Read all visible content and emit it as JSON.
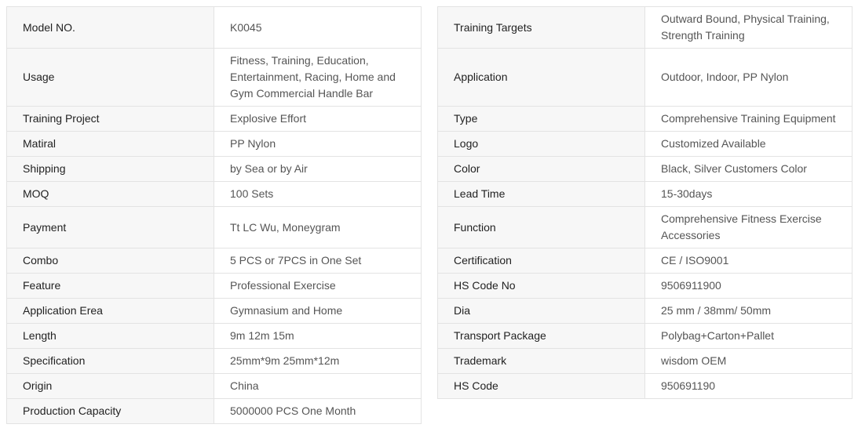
{
  "left_table": [
    {
      "label": "Model NO.",
      "value": "K0045"
    },
    {
      "label": "Usage",
      "value": "Fitness, Training, Education, Entertainment, Racing, Home and Gym Commercial Handle Bar"
    },
    {
      "label": "Training Project",
      "value": "Explosive Effort"
    },
    {
      "label": "Matiral",
      "value": "PP Nylon"
    },
    {
      "label": "Shipping",
      "value": "by Sea or by Air"
    },
    {
      "label": "MOQ",
      "value": "100 Sets"
    },
    {
      "label": "Payment",
      "value": "Tt LC Wu, Moneygram"
    },
    {
      "label": "Combo",
      "value": "5 PCS or 7PCS in One Set"
    },
    {
      "label": "Feature",
      "value": "Professional Exercise"
    },
    {
      "label": "Application Erea",
      "value": "Gymnasium and Home"
    },
    {
      "label": "Length",
      "value": "9m 12m 15m"
    },
    {
      "label": "Specification",
      "value": "25mm*9m 25mm*12m"
    },
    {
      "label": "Origin",
      "value": "China"
    },
    {
      "label": "Production Capacity",
      "value": "5000000 PCS One Month"
    }
  ],
  "right_table": [
    {
      "label": "Training Targets",
      "value": "Outward Bound, Physical Training, Strength Training"
    },
    {
      "label": "Application",
      "value": "Outdoor, Indoor, PP Nylon"
    },
    {
      "label": "Type",
      "value": "Comprehensive Training Equipment"
    },
    {
      "label": "Logo",
      "value": "Customized Available"
    },
    {
      "label": "Color",
      "value": "Black, Silver Customers Color"
    },
    {
      "label": "Lead Time",
      "value": "15-30days"
    },
    {
      "label": "Function",
      "value": "Comprehensive Fitness Exercise Accessories"
    },
    {
      "label": "Certification",
      "value": "CE / ISO9001"
    },
    {
      "label": "HS Code No",
      "value": "9506911900"
    },
    {
      "label": "Dia",
      "value": "25 mm / 38mm/ 50mm"
    },
    {
      "label": "Transport Package",
      "value": "Polybag+Carton+Pallet"
    },
    {
      "label": "Trademark",
      "value": "wisdom OEM"
    },
    {
      "label": "HS Code",
      "value": "950691190"
    }
  ]
}
